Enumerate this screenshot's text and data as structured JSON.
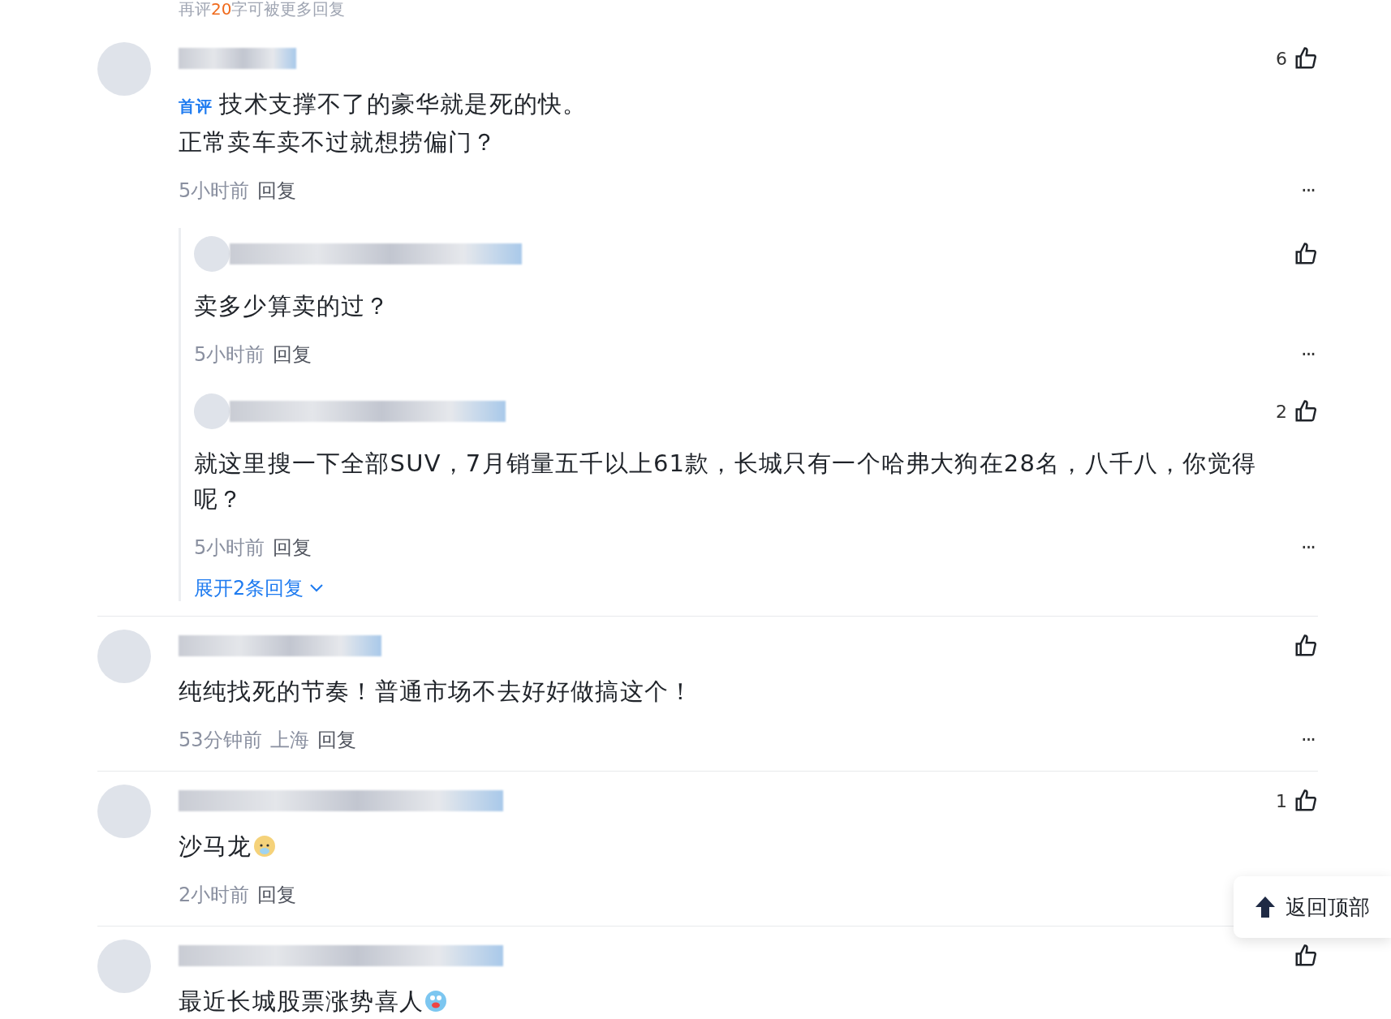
{
  "top_hint": {
    "prefix": "再评",
    "count": "20",
    "suffix": "字可被更多回复"
  },
  "comments": [
    {
      "badge": "首评",
      "lines": [
        "技术支撑不了的豪华就是死的快。",
        "正常卖车卖不过就想捞偏门？"
      ],
      "likes": "6",
      "time": "5小时前",
      "reply_label": "回复",
      "more": "···",
      "replies": [
        {
          "lines": [
            "卖多少算卖的过？"
          ],
          "time": "5小时前",
          "reply_label": "回复",
          "more": "···"
        },
        {
          "lines": [
            "就这里搜一下全部SUV，7月销量五千以上61款，长城只有一个哈弗大狗在28名，八千八，你觉得呢？"
          ],
          "likes": "2",
          "time": "5小时前",
          "reply_label": "回复",
          "more": "···"
        }
      ],
      "expand": "展开2条回复"
    },
    {
      "lines": [
        "纯纯找死的节奏！普通市场不去好好做搞这个！"
      ],
      "time": "53分钟前",
      "location": "上海",
      "reply_label": "回复",
      "more": "···"
    },
    {
      "lines": [
        "沙马龙"
      ],
      "emoji": true,
      "likes": "1",
      "time": "2小时前",
      "reply_label": "回复"
    },
    {
      "lines": [
        "最近长城股票涨势喜人"
      ],
      "emoji": true
    }
  ],
  "back_to_top": "返回顶部"
}
